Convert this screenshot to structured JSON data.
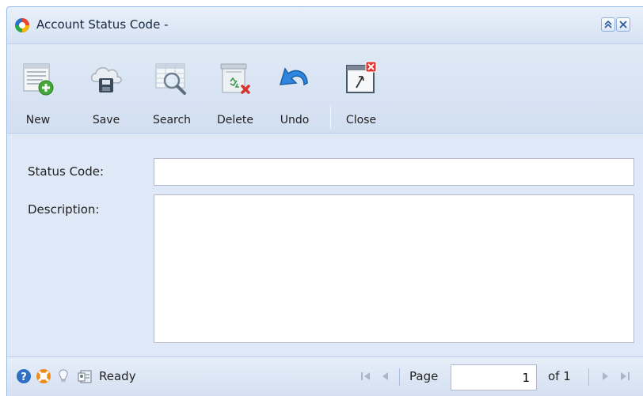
{
  "window": {
    "title": "Account Status Code -"
  },
  "toolbar": {
    "items": [
      {
        "label": "New",
        "icon": "new-record-icon"
      },
      {
        "label": "Save",
        "icon": "save-cloud-icon"
      },
      {
        "label": "Search",
        "icon": "search-grid-icon"
      },
      {
        "label": "Delete",
        "icon": "delete-bin-icon"
      },
      {
        "label": "Undo",
        "icon": "undo-arrow-icon"
      },
      {
        "label": "Close",
        "icon": "close-window-icon"
      }
    ]
  },
  "form": {
    "status_code_label": "Status Code:",
    "status_code_value": "",
    "description_label": "Description:",
    "description_value": ""
  },
  "statusbar": {
    "status": "Ready",
    "page_label": "Page",
    "page_value": "1",
    "page_of": "of 1"
  },
  "colors": {
    "panel_bg": "#dfe8f6",
    "border": "#99bbe8",
    "accent_blue": "#1e73d8"
  }
}
